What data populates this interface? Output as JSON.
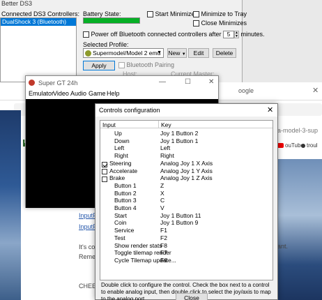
{
  "ds3": {
    "title": "Better DS3",
    "connected_label": "Connected DS3 Controllers:",
    "controllers": [
      "DualShock 3 (Bluetooth)"
    ],
    "battery_label": "Battery State:",
    "start_minimized": "Start Minimized",
    "minimize_to_tray": "Minimize to Tray",
    "close_minimizes": "Close Minimizes",
    "power_off_label": "Power off Bluetooth connected controllers after",
    "power_off_minutes": "5",
    "minutes_label": "minutes.",
    "selected_profile_label": "Selected Profile:",
    "selected_profile": "Supermodel/Model 2 emu",
    "new_label": "New",
    "edit_label": "Edit",
    "delete_label": "Delete",
    "apply_label": "Apply",
    "bluetooth_pairing": "Bluetooth Pairing",
    "host_label": "Host:",
    "current_master_label": "Current Master:",
    "battery_color": "#06b025"
  },
  "supergt": {
    "title": "Super GT 24h",
    "menu": [
      "Emulator",
      "Video",
      "Audio",
      "Game",
      "Help"
    ],
    "min": "—",
    "max": "☐",
    "close": "✕"
  },
  "browser": {
    "tab_text": "oogle",
    "url_fragment": "a-model-3-sup",
    "youtube": "ouTube",
    "trou": "troul",
    "link1": "InputF",
    "link2": "InputF",
    "text1": "It's co",
    "text2": "Reme",
    "text3": "CHEE",
    "want": "ant."
  },
  "controls_dialog": {
    "title": "Controls configuration",
    "col_input": "Input",
    "col_key": "Key",
    "rows": [
      {
        "input": "Up",
        "key": "Joy 1 Button 2",
        "checkbox": false
      },
      {
        "input": "Down",
        "key": "Joy 1 Button 1",
        "checkbox": false
      },
      {
        "input": "Left",
        "key": "Left",
        "checkbox": false
      },
      {
        "input": "Right",
        "key": "Right",
        "checkbox": false
      },
      {
        "input": "Steering",
        "key": "Analog Joy 1 X Axis",
        "checkbox": true,
        "checked": true
      },
      {
        "input": "Accelerate",
        "key": "Analog Joy 1 Y Axis",
        "checkbox": true,
        "checked": false
      },
      {
        "input": "Brake",
        "key": "Analog Joy 1 Z Axis",
        "checkbox": true,
        "checked": false
      },
      {
        "input": "Button 1",
        "key": "Z",
        "checkbox": false
      },
      {
        "input": "Button 2",
        "key": "X",
        "checkbox": false
      },
      {
        "input": "Button 3",
        "key": "C",
        "checkbox": false
      },
      {
        "input": "Button 4",
        "key": "V",
        "checkbox": false
      },
      {
        "input": "Start",
        "key": "Joy 1 Button 11",
        "checkbox": false
      },
      {
        "input": "Coin",
        "key": "Joy 1 Button 9",
        "checkbox": false
      },
      {
        "input": "Service",
        "key": "F1",
        "checkbox": false
      },
      {
        "input": "Test",
        "key": "F2",
        "checkbox": false
      },
      {
        "input": "Show render stats",
        "key": "F8",
        "checkbox": false
      },
      {
        "input": "Toggle tilemap render",
        "key": "F7",
        "checkbox": false
      },
      {
        "input": "Cycle Tilemap update...",
        "key": "F6",
        "checkbox": false
      }
    ],
    "help_text": "Double click to configure the control. Check the box next to a control to enable analog input, then double click to select the joy/axis to map to the analog port",
    "close_label": "Close"
  }
}
